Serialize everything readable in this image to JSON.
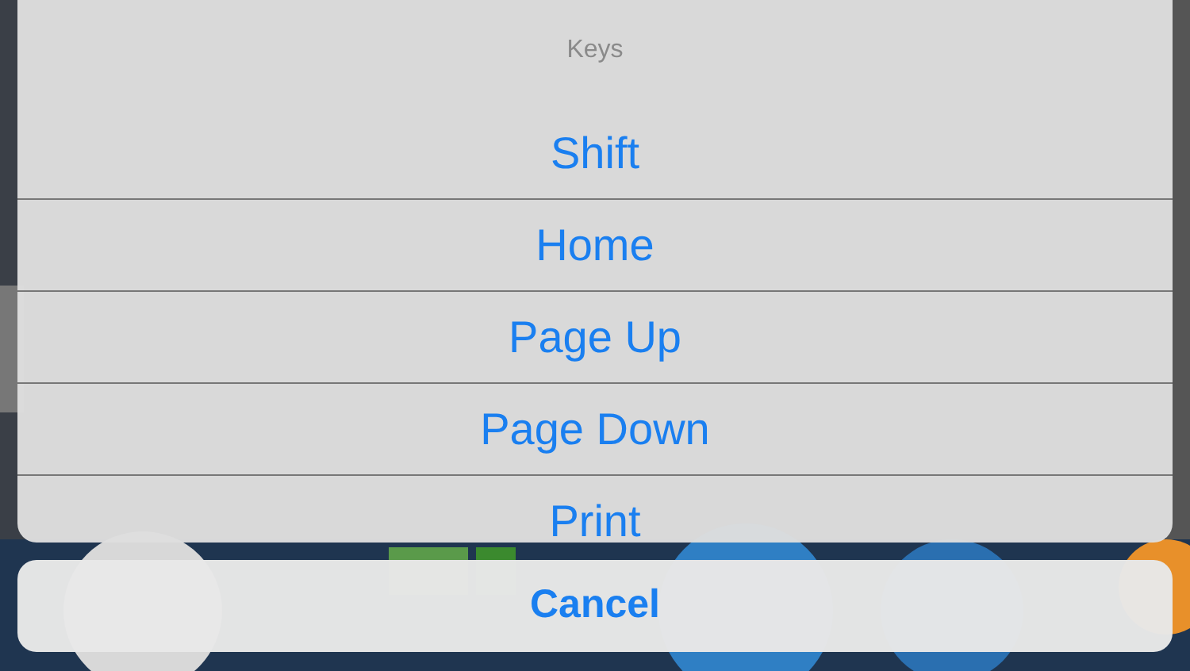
{
  "action_sheet": {
    "title": "Keys",
    "options": [
      {
        "label": "Shift"
      },
      {
        "label": "Home"
      },
      {
        "label": "Page Up"
      },
      {
        "label": "Page Down"
      },
      {
        "label": "Print"
      }
    ],
    "cancel": {
      "label": "Cancel"
    }
  }
}
